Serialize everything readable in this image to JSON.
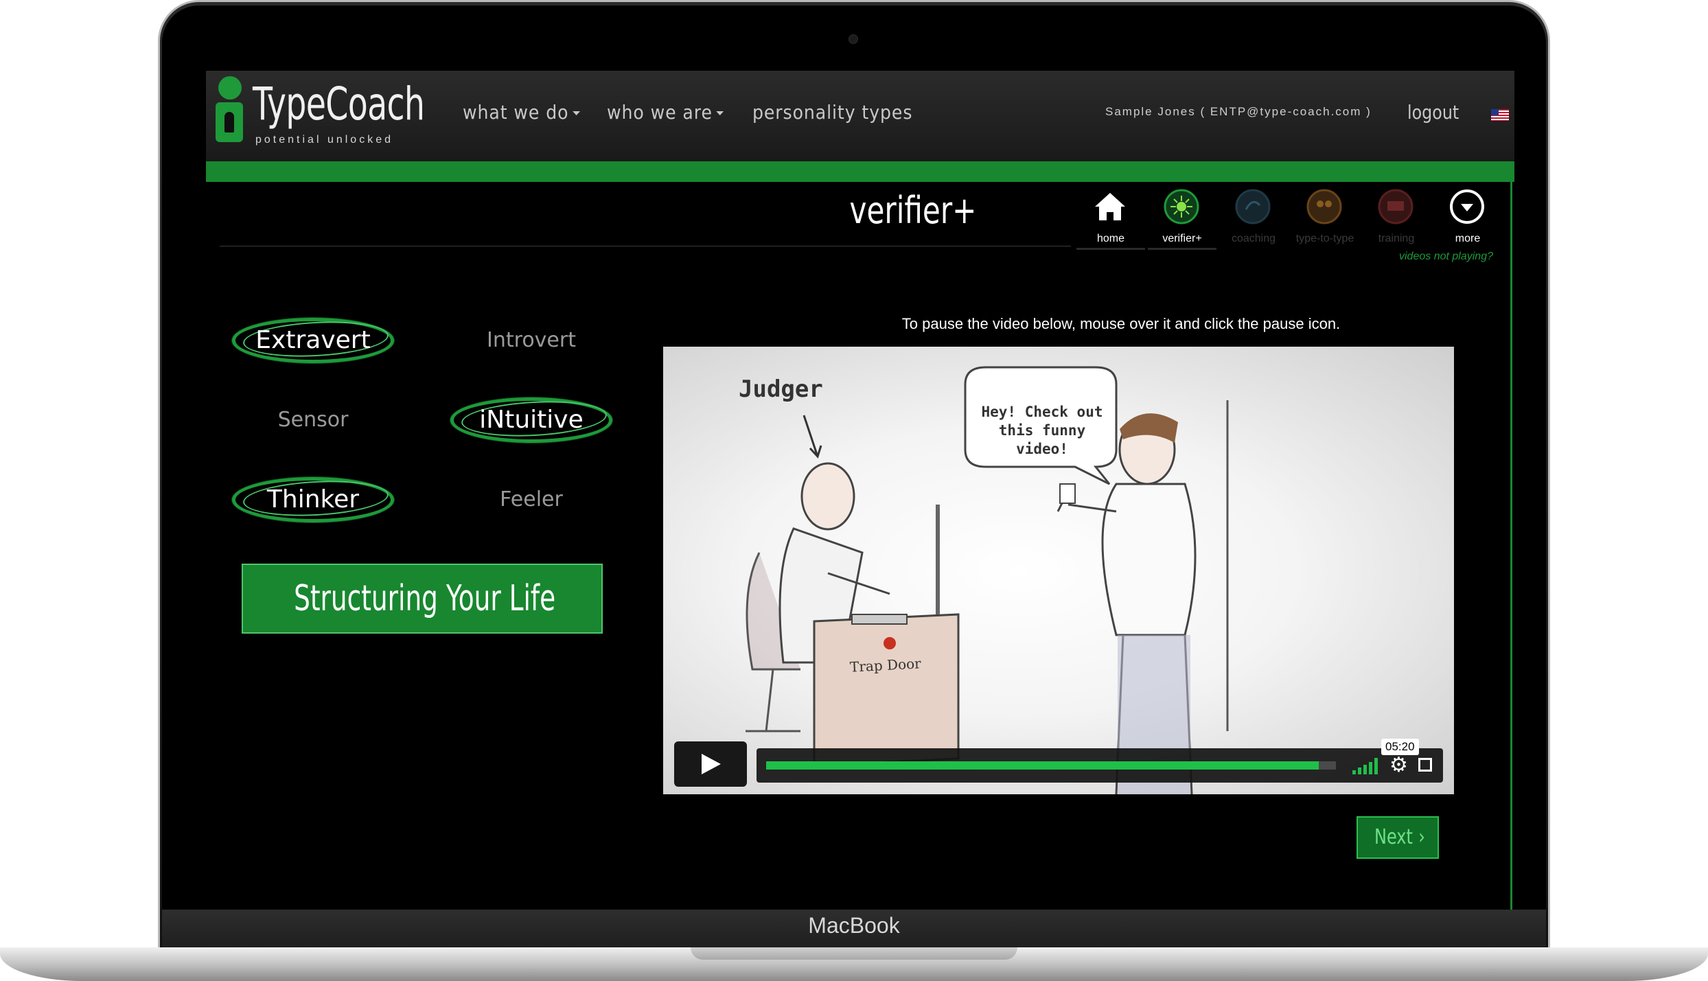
{
  "device": {
    "label": "MacBook"
  },
  "brand": {
    "name": "TypeCoach",
    "tagline": "potential unlocked"
  },
  "nav": {
    "items": [
      "what we do",
      "who we are",
      "personality types"
    ],
    "user": "Sample Jones ( ENTP@type-coach.com )",
    "logout": "logout",
    "flag_icon": "us-flag-icon"
  },
  "page": {
    "title": "verifier+",
    "videos_hint": "videos not playing?"
  },
  "tabs": [
    {
      "label": "home",
      "icon": "home-icon",
      "active": true
    },
    {
      "label": "verifier+",
      "icon": "verifier-icon",
      "active": true
    },
    {
      "label": "coaching",
      "icon": "coaching-icon",
      "active": false
    },
    {
      "label": "type-to-type",
      "icon": "type-to-type-icon",
      "active": false
    },
    {
      "label": "training",
      "icon": "training-icon",
      "active": false
    },
    {
      "label": "more",
      "icon": "more-icon",
      "active": true
    }
  ],
  "types": {
    "extravert": "Extravert",
    "introvert": "Introvert",
    "sensor": "Sensor",
    "intuitive": "iNtuitive",
    "thinker": "Thinker",
    "feeler": "Feeler"
  },
  "lesson_button": "Structuring Your Life",
  "video": {
    "instructions": "To pause the video below, mouse over it and click the pause icon.",
    "scene": {
      "judger_label": "Judger",
      "speech": "Hey! Check out this funny video!",
      "desk_label": "Trap Door"
    },
    "time": "05:20",
    "progress": 0.97
  },
  "next_button": "Next",
  "colors": {
    "accent": "#18872f",
    "progress": "#1fbf4a"
  }
}
